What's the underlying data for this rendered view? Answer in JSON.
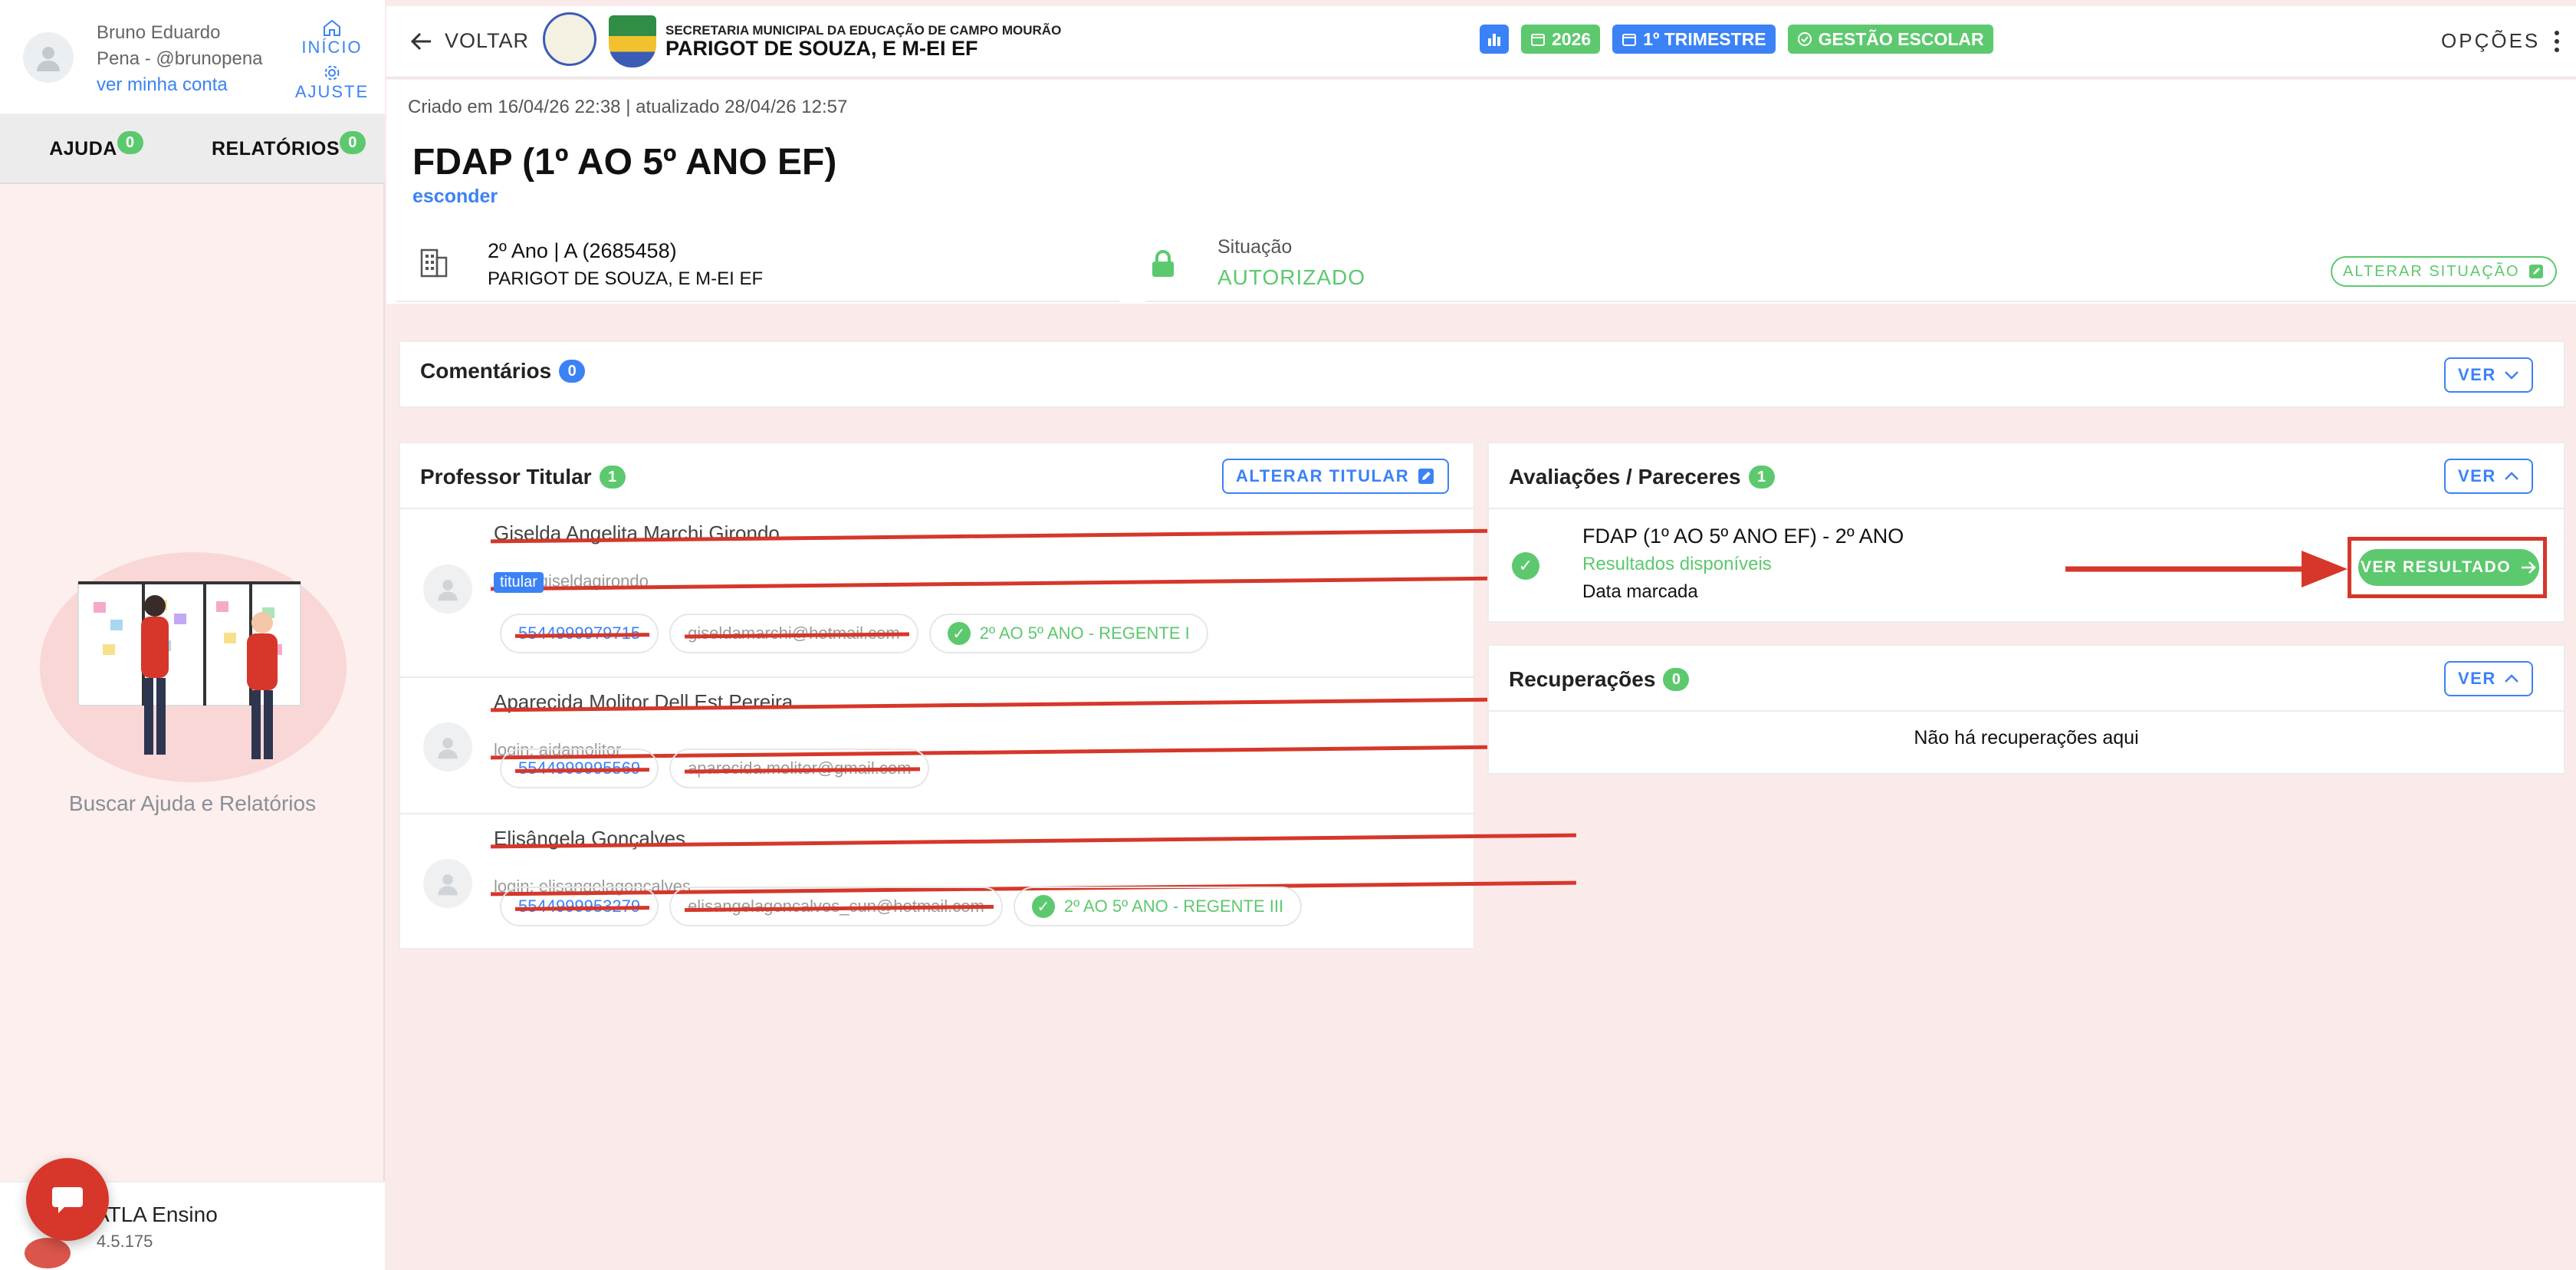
{
  "sidebar": {
    "user_name_line1": "Bruno Eduardo",
    "user_name_line2": "Pena - @brunopena",
    "account_link": "ver minha conta",
    "home_label": "INÍCIO",
    "settings_label": "AJUSTE",
    "tabs": [
      {
        "label": "AJUDA",
        "count": "0"
      },
      {
        "label": "RELATÓRIOS",
        "count": "0"
      }
    ],
    "empty_caption": "Buscar Ajuda e Relatórios",
    "app_name": "ATLA Ensino",
    "app_version": "4.5.175"
  },
  "header": {
    "back_label": "VOLTAR",
    "secretaria": "SECRETARIA MUNICIPAL DA EDUCAÇÃO DE CAMPO MOURÃO",
    "school": "PARIGOT DE SOUZA, E M-EI EF",
    "year": "2026",
    "period": "1º TRIMESTRE",
    "mode": "GESTÃO ESCOLAR",
    "options_label": "OPÇÕES"
  },
  "record": {
    "meta": "Criado em 16/04/26 22:38 | atualizado 28/04/26 12:57",
    "title": "FDAP (1º AO 5º ANO EF)",
    "hide_link": "esconder",
    "class_name": "2º Ano | A (2685458)",
    "class_school": "PARIGOT DE SOUZA, E M-EI EF",
    "status_label": "Situação",
    "status_value": "AUTORIZADO",
    "change_status_label": "ALTERAR SITUAÇÃO"
  },
  "comments": {
    "title": "Comentários",
    "count": "0",
    "view_label": "VER"
  },
  "teachers": {
    "title": "Professor Titular",
    "count": "1",
    "change_label": "ALTERAR TITULAR",
    "items": [
      {
        "name": "Giselda Angelita Marchi Girondo",
        "login": "login: giseldagirondo",
        "tag": "titular",
        "phone": "5544999979715",
        "email": "giseldamarchi@hotmail.com",
        "role": "2º AO 5º ANO - REGENTE I"
      },
      {
        "name": "Aparecida Molitor Dell Est Pereira",
        "login": "login: aidamolitor",
        "tag": "",
        "phone": "5544999995569",
        "email": "aparecida.molitor@gmail.com",
        "role": ""
      },
      {
        "name": "Elisângela Gonçalves",
        "login": "login: elisangelagoncalves",
        "tag": "",
        "phone": "5544999953279",
        "email": "elisangelagoncalves_cun@hotmail.com",
        "role": "2º AO 5º ANO - REGENTE III"
      }
    ]
  },
  "evaluations": {
    "title": "Avaliações / Pareceres",
    "count": "1",
    "view_label": "VER",
    "item_title": "FDAP (1º AO 5º ANO EF) - 2º ANO",
    "item_status": "Resultados disponíveis",
    "item_date": "Data marcada",
    "result_button": "VER RESULTADO"
  },
  "recoveries": {
    "title": "Recuperações",
    "count": "0",
    "view_label": "VER",
    "empty_text": "Não há recuperações aqui"
  },
  "colors": {
    "accent_blue": "#3b82f6",
    "success_green": "#5cc96e",
    "annotation_red": "#d6372a"
  }
}
